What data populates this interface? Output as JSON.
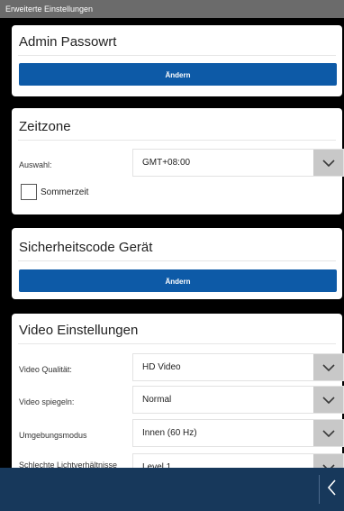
{
  "window": {
    "title": "Erweiterte Einstellungen"
  },
  "admin_password": {
    "title": "Admin Passowrt",
    "change_label": "Ändern"
  },
  "timezone": {
    "title": "Zeitzone",
    "selection_label": "Auswahl:",
    "selection_value": "GMT+08:00",
    "dst_label": "Sommerzeit",
    "dst_checked": false
  },
  "security_code": {
    "title": "Sicherheitscode Gerät",
    "change_label": "Ändern"
  },
  "video_settings": {
    "title": "Video Einstellungen",
    "rows": [
      {
        "label": "Video Qualität:",
        "value": "HD Video"
      },
      {
        "label": "Video spiegeln:",
        "value": "Normal"
      },
      {
        "label": "Umgebungsmodus",
        "value": "Innen (60 Hz)"
      },
      {
        "label": "Schlechte Lichtverhältnisse",
        "value": "Level 1"
      }
    ]
  },
  "icons": {
    "dropdown": "chevron-down-icon",
    "back": "chevron-left-icon"
  },
  "colors": {
    "accent": "#0d5aa7",
    "bottom_bar": "#17385b",
    "title_bar": "#6b6b6b"
  }
}
